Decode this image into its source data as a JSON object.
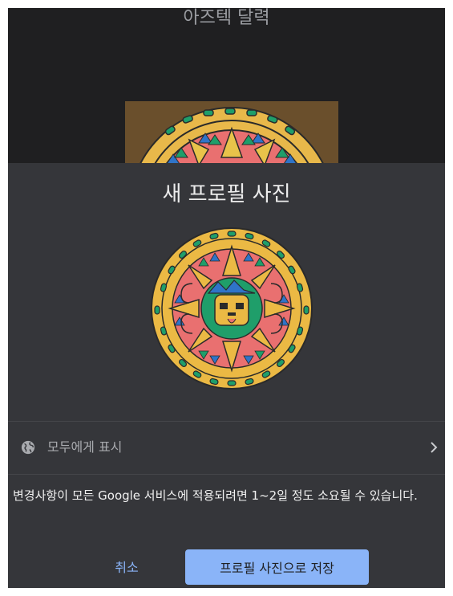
{
  "background": {
    "title": "아즈텍 달력"
  },
  "dialog": {
    "title": "새 프로필 사진",
    "visibility": {
      "icon": "globe-icon",
      "label": "모두에게 표시",
      "chevron_icon": "chevron-right-icon"
    },
    "notice": "변경사항이 모든 Google 서비스에 적용되려면 1~2일 정도 소요될 수 있습니다.",
    "cancel_label": "취소",
    "save_label": "프로필 사진으로 저장"
  },
  "colors": {
    "accent": "#8ab4f8",
    "sheet": "#35363a",
    "backdrop": "#1f1f21"
  }
}
